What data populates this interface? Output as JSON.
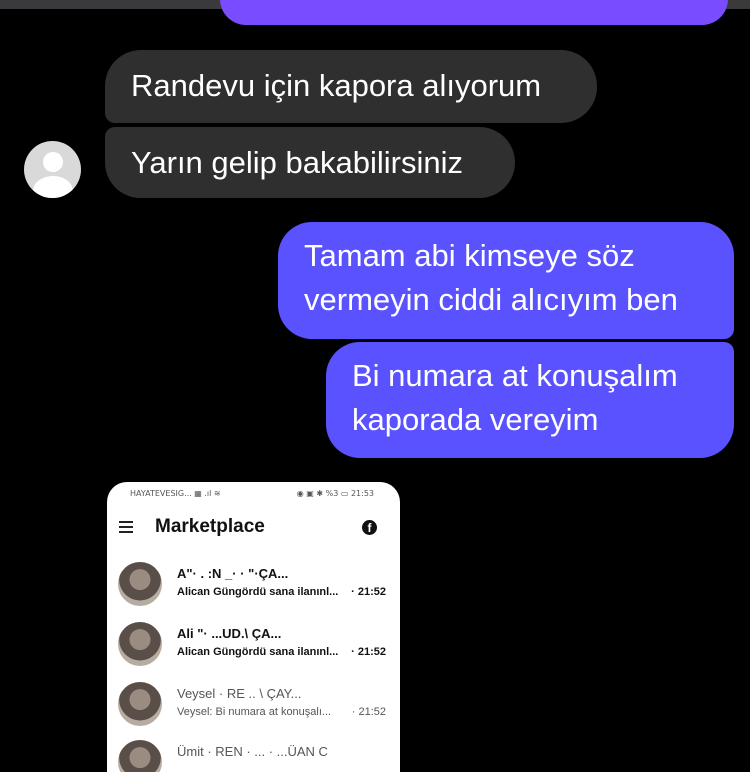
{
  "messages": [
    {
      "text": "Randevu için kapora alıyorum"
    },
    {
      "text": "Yarın gelip bakabilirsiniz"
    },
    {
      "text": "Tamam abi kimseye söz vermeyin ciddi alıcıyım ben"
    },
    {
      "text": "Bi numara at konuşalım kaporada vereyim"
    }
  ],
  "attachment": {
    "status_left": "HAYATEVESIG... ▦ .ıl ≋",
    "status_right": "◉ ▣ ✱ %3 ▭ 21:53",
    "app_title": "Marketplace",
    "conversations": [
      {
        "title": "A\"·  .  :N        _·  · \"·ÇA...",
        "subtitle": "Alican Güngördü sana ilanınl...",
        "time": "· 21:52"
      },
      {
        "title": "Ali         \"·            ...UD.\\ ÇA...",
        "subtitle": "Alican Güngördü sana ilanınl...",
        "time": "· 21:52"
      },
      {
        "title": "Veysel · RE         ..                  \\ ÇAY...",
        "subtitle": "Veysel: Bi numara at konuşalı...",
        "time": "· 21:52"
      },
      {
        "title": "Ümit · REN · ...  · ...ÜAN C",
        "subtitle": "",
        "time": ""
      }
    ]
  },
  "colors": {
    "background": "#000000",
    "incoming_bubble": "#2f2f2f",
    "outgoing_bubble": "#5b52ff"
  }
}
